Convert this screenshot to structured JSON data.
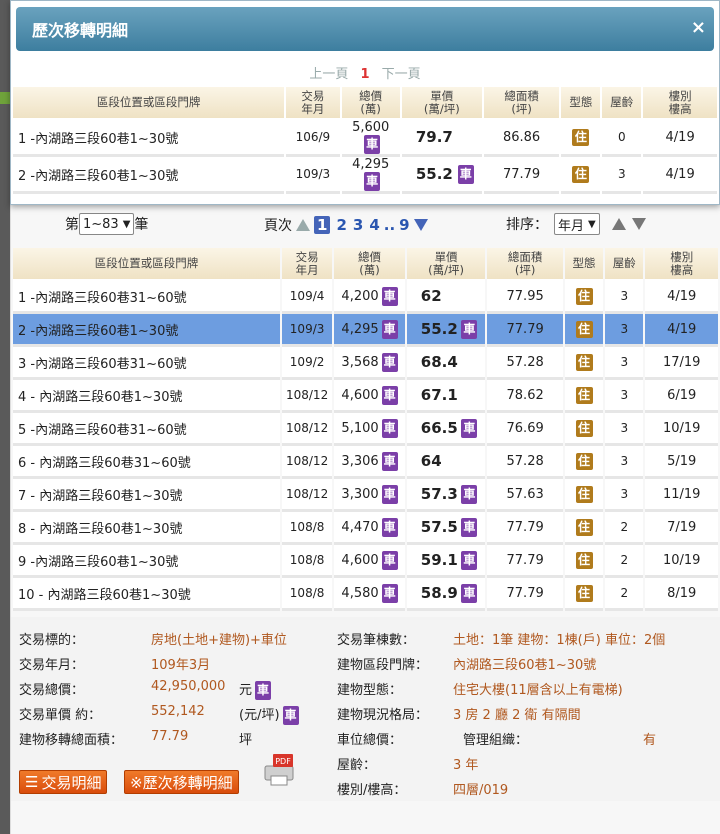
{
  "popup": {
    "title": "歷次移轉明細",
    "close_label": "×",
    "pager": {
      "prev": "上一頁",
      "current": "1",
      "next": "下一頁"
    },
    "headers": [
      "區段位置或區段門牌",
      "交易\n年月",
      "總價\n(萬)",
      "單價\n(萬/坪)",
      "總面積\n(坪)",
      "型態",
      "屋齡",
      "樓別\n樓高"
    ],
    "rows": [
      {
        "loc": "1 -內湖路三段60巷1~30號",
        "ym": "106/9",
        "total": "5,600",
        "total_car": true,
        "unit": "79.7",
        "unit_car": false,
        "area": "86.86",
        "type": "住",
        "age": "0",
        "floor": "4/19"
      },
      {
        "loc": "2 -內湖路三段60巷1~30號",
        "ym": "109/3",
        "total": "4,295",
        "total_car": true,
        "unit": "55.2",
        "unit_car": true,
        "area": "77.79",
        "type": "住",
        "age": "3",
        "floor": "4/19"
      }
    ]
  },
  "controls": {
    "range_prefix": "第",
    "range_value": "1~83",
    "range_suffix": "筆",
    "pages_label": "頁次",
    "pages": [
      "1",
      "2",
      "3",
      "4"
    ],
    "ellipsis": "..",
    "last_page": "9",
    "sort_label": "排序：",
    "sort_value": "年月"
  },
  "main_table": {
    "headers": [
      "區段位置或區段門牌",
      "交易\n年月",
      "總價\n(萬)",
      "單價\n(萬/坪)",
      "總面積\n(坪)",
      "型態",
      "屋齡",
      "樓別\n樓高"
    ],
    "rows": [
      {
        "loc": "1 -內湖路三段60巷31~60號",
        "ym": "109/4",
        "total": "4,200",
        "total_car": true,
        "unit": "62",
        "unit_car": false,
        "area": "77.95",
        "type": "住",
        "age": "3",
        "floor": "4/19",
        "selected": false
      },
      {
        "loc": "2 -內湖路三段60巷1~30號",
        "ym": "109/3",
        "total": "4,295",
        "total_car": true,
        "unit": "55.2",
        "unit_car": true,
        "area": "77.79",
        "type": "住",
        "age": "3",
        "floor": "4/19",
        "selected": true
      },
      {
        "loc": "3 -內湖路三段60巷31~60號",
        "ym": "109/2",
        "total": "3,568",
        "total_car": true,
        "unit": "68.4",
        "unit_car": false,
        "area": "57.28",
        "type": "住",
        "age": "3",
        "floor": "17/19",
        "selected": false
      },
      {
        "loc": "4 - 內湖路三段60巷1~30號",
        "ym": "108/12",
        "total": "4,600",
        "total_car": true,
        "unit": "67.1",
        "unit_car": false,
        "area": "78.62",
        "type": "住",
        "age": "3",
        "floor": "6/19",
        "selected": false
      },
      {
        "loc": "5 -內湖路三段60巷31~60號",
        "ym": "108/12",
        "total": "5,100",
        "total_car": true,
        "unit": "66.5",
        "unit_car": true,
        "area": "76.69",
        "type": "住",
        "age": "3",
        "floor": "10/19",
        "selected": false
      },
      {
        "loc": "6 - 內湖路三段60巷31~60號",
        "ym": "108/12",
        "total": "3,306",
        "total_car": true,
        "unit": "64",
        "unit_car": false,
        "area": "57.28",
        "type": "住",
        "age": "3",
        "floor": "5/19",
        "selected": false
      },
      {
        "loc": "7 - 內湖路三段60巷1~30號",
        "ym": "108/12",
        "total": "3,300",
        "total_car": true,
        "unit": "57.3",
        "unit_car": true,
        "area": "57.63",
        "type": "住",
        "age": "3",
        "floor": "11/19",
        "selected": false
      },
      {
        "loc": "8 - 內湖路三段60巷1~30號",
        "ym": "108/8",
        "total": "4,470",
        "total_car": true,
        "unit": "57.5",
        "unit_car": true,
        "area": "77.79",
        "type": "住",
        "age": "2",
        "floor": "7/19",
        "selected": false
      },
      {
        "loc": "9 -內湖路三段60巷1~30號",
        "ym": "108/8",
        "total": "4,600",
        "total_car": true,
        "unit": "59.1",
        "unit_car": true,
        "area": "77.79",
        "type": "住",
        "age": "2",
        "floor": "10/19",
        "selected": false
      },
      {
        "loc": "10 - 內湖路三段60巷1~30號",
        "ym": "108/8",
        "total": "4,580",
        "total_car": true,
        "unit": "58.9",
        "unit_car": true,
        "area": "77.79",
        "type": "住",
        "age": "2",
        "floor": "8/19",
        "selected": false
      }
    ]
  },
  "detail": {
    "target_label": "交易標的：",
    "target_value": "房地(土地+建物)+車位",
    "ym_label": "交易年月：",
    "ym_value": "109年3月",
    "total_label": "交易總價：",
    "total_value": "42,950,000",
    "total_unit": "元",
    "unit_label": "交易單價 約：",
    "unit_value": "552,142",
    "unit_unit": "(元/坪)",
    "area_label": "建物移轉總面積：",
    "area_value": "77.79",
    "area_unit": "坪",
    "count_label": "交易筆棟數：",
    "count_value": "土地：1筆 建物：1棟(戶) 車位：2個",
    "addr_label": "建物區段門牌：",
    "addr_value": "內湖路三段60巷1~30號",
    "btype_label": "建物型態：",
    "btype_value": "住宅大樓(11層含以上有電梯)",
    "layout_label": "建物現況格局：",
    "layout_value": "3 房 2 廳 2 衛 有隔間",
    "park_label": "車位總價：",
    "mgmt_label": "管理組織：",
    "mgmt_value": "有",
    "age_label": "屋齡：",
    "age_value": "3 年",
    "floor_label": "樓別/樓高：",
    "floor_value": "四層/019",
    "btn_detail": "交易明細",
    "btn_history": "※歷次移轉明細",
    "car_char": "車",
    "zhu_char": "住",
    "pdf_label": "PDF"
  }
}
